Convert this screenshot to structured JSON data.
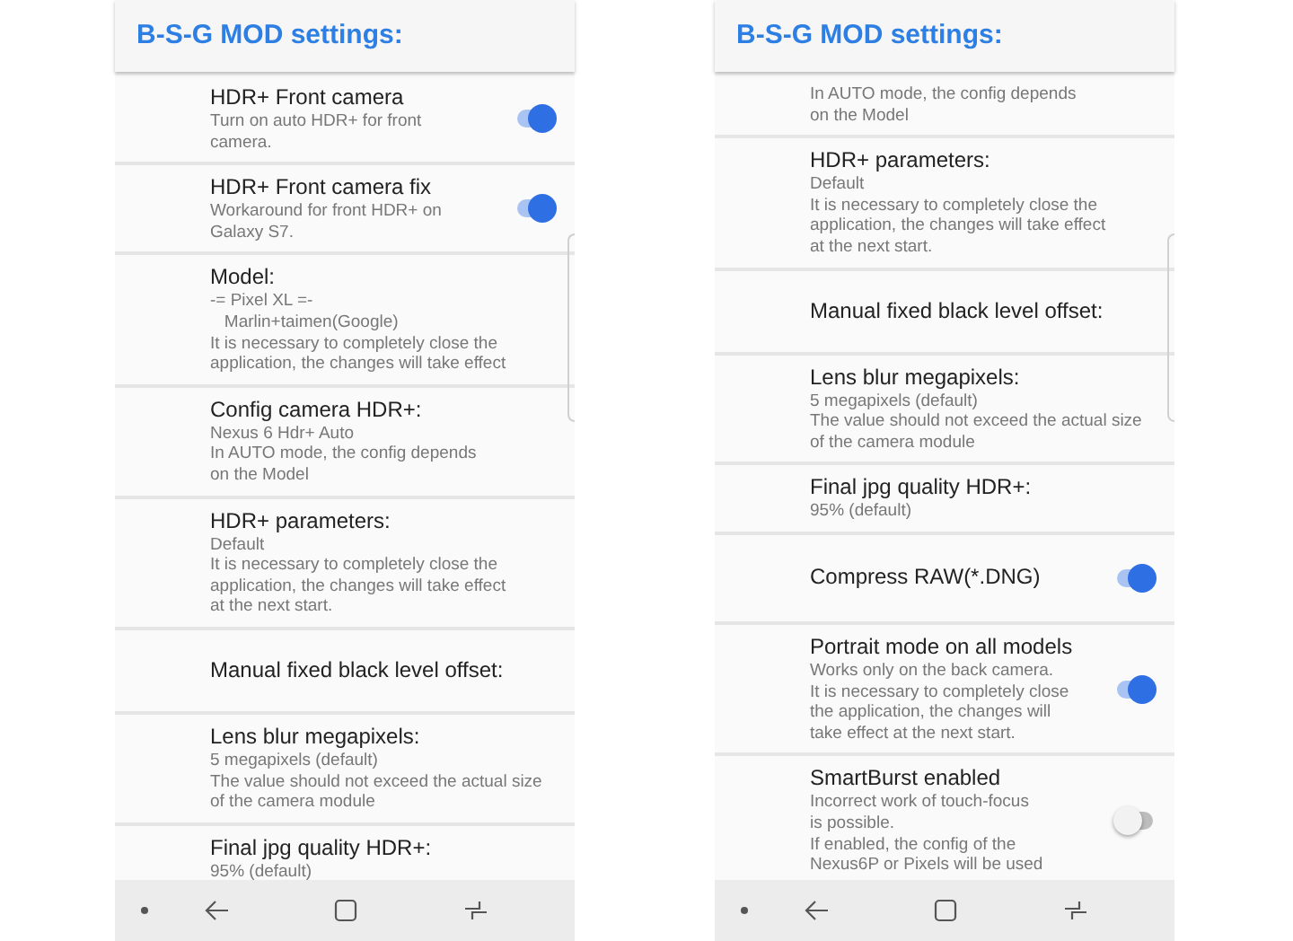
{
  "phones": [
    {
      "title": "B-S-G MOD settings:",
      "rows": [
        {
          "kind": "toggle",
          "title": "HDR+ Front camera",
          "description": "Turn on auto HDR+ for front\ncamera.",
          "on": true
        },
        {
          "kind": "toggle",
          "title": "HDR+ Front camera fix",
          "description": "Workaround for front HDR+ on\nGalaxy S7.",
          "on": true
        },
        {
          "kind": "text",
          "title": "Model:",
          "description": "-= Pixel XL =-\n   Marlin+taimen(Google)\nIt is necessary to completely close the\napplication, the changes will take effect"
        },
        {
          "kind": "text",
          "title": "Config camera HDR+:",
          "description": "Nexus 6 Hdr+ Auto\nIn AUTO mode, the config depends\non the Model"
        },
        {
          "kind": "text",
          "title": "HDR+ parameters:",
          "description": "Default\nIt is necessary to completely close the\napplication, the changes will take effect\nat the next start."
        },
        {
          "kind": "text",
          "title": "Manual fixed black level offset:"
        },
        {
          "kind": "text",
          "title": "Lens blur megapixels:",
          "description": "5 megapixels (default)\nThe value should not exceed the actual size\nof the camera module"
        },
        {
          "kind": "text",
          "title": "Final jpg quality HDR+:",
          "description": "95% (default)"
        }
      ]
    },
    {
      "title": "B-S-G MOD settings:",
      "rows": [
        {
          "kind": "text",
          "description": "In AUTO mode, the config depends\non the Model"
        },
        {
          "kind": "text",
          "title": "HDR+ parameters:",
          "description": "Default\nIt is necessary to completely close the\napplication, the changes will take effect\nat the next start."
        },
        {
          "kind": "text",
          "title": "Manual fixed black level offset:"
        },
        {
          "kind": "text",
          "title": "Lens blur megapixels:",
          "description": "5 megapixels (default)\nThe value should not exceed the actual size\nof the camera module"
        },
        {
          "kind": "text",
          "title": "Final jpg quality HDR+:",
          "description": "95% (default)"
        },
        {
          "kind": "toggle",
          "title": "Compress RAW(*.DNG)",
          "on": true
        },
        {
          "kind": "toggle",
          "title": "Portrait mode on all models",
          "description": "Works only on the back camera.\nIt is necessary to completely close\nthe application, the changes will\ntake effect at the next start.",
          "on": true
        },
        {
          "kind": "toggle",
          "title": "SmartBurst enabled",
          "description": "Incorrect work of touch-focus\nis possible.\nIf enabled, the config of the\nNexus6P or Pixels will be used",
          "on": false
        }
      ]
    }
  ]
}
